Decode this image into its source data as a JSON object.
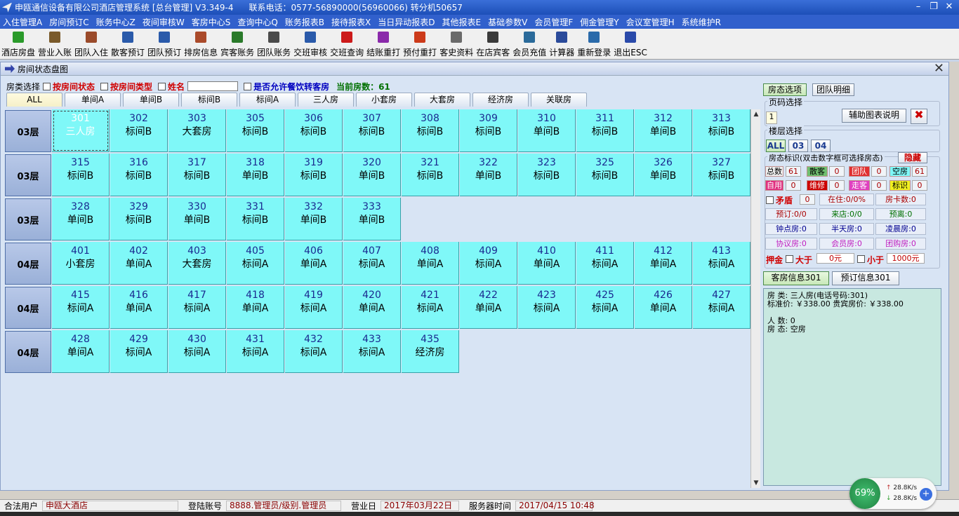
{
  "app": {
    "title": "申瓯通信设备有限公司酒店管理系统 [总台管理] V3.349-4",
    "phone": "联系电话：0577-56890000(56960066) 转分机50657"
  },
  "menu": [
    "入住管理A",
    "房间预订C",
    "账务中心Z",
    "夜间审核W",
    "客房中心S",
    "查询中心Q",
    "账务报表B",
    "接待报表X",
    "当日异动报表D",
    "其他报表E",
    "基础参数V",
    "会员管理F",
    "佣金管理Y",
    "会议室管理H",
    "系统维护R"
  ],
  "toolbar": [
    {
      "label": "酒店房盘",
      "icon": "house-icon",
      "color": "#2a9a2a"
    },
    {
      "label": "营业入账",
      "icon": "ledger-icon",
      "color": "#7a5a2a"
    },
    {
      "label": "团队入住",
      "icon": "group-checkin-icon",
      "color": "#9a4a2a"
    },
    {
      "label": "散客预订",
      "icon": "person-booking-icon",
      "color": "#2a5aaa"
    },
    {
      "label": "团队预订",
      "icon": "group-booking-icon",
      "color": "#2a5aaa"
    },
    {
      "label": "排房信息",
      "icon": "arrange-icon",
      "color": "#aa4a2a"
    },
    {
      "label": "宾客账务",
      "icon": "folder-icon",
      "color": "#2a7a2a"
    },
    {
      "label": "团队账务",
      "icon": "team-account-icon",
      "color": "#4a4a4a"
    },
    {
      "label": "交班审核",
      "icon": "magnifier-icon",
      "color": "#2a5aaa"
    },
    {
      "label": "交班查询",
      "icon": "red-book-icon",
      "color": "#cc1a1a"
    },
    {
      "label": "结账重打",
      "icon": "books-icon",
      "color": "#8a2aaa"
    },
    {
      "label": "预付重打",
      "icon": "receipt-icon",
      "color": "#cc3a1a"
    },
    {
      "label": "客史资料",
      "icon": "history-icon",
      "color": "#6a6a6a"
    },
    {
      "label": "在店宾客",
      "icon": "guest-list-icon",
      "color": "#3a3a3a"
    },
    {
      "label": "会员充值",
      "icon": "card-icon",
      "color": "#2a6a9a"
    },
    {
      "label": "计算器",
      "icon": "calculator-icon",
      "color": "#2a4a9a"
    },
    {
      "label": "重新登录",
      "icon": "relogin-icon",
      "color": "#2a6aaa"
    },
    {
      "label": "退出ESC",
      "icon": "exit-icon",
      "color": "#2a4aaa"
    }
  ],
  "window": {
    "title": "房间状态盘图"
  },
  "filter": {
    "room_type_label": "房类选择",
    "by_status": "按房间状态",
    "by_type": "按房间类型",
    "name_label": "姓名",
    "name_value": "",
    "allow_dining": "是否允许餐饮转客房",
    "current_rooms": "当前房数：61"
  },
  "tabs": [
    "ALL",
    "单间A",
    "单间B",
    "标间B",
    "标间A",
    "三人房",
    "小套房",
    "大套房",
    "经济房",
    "关联房"
  ],
  "floors": [
    {
      "label": "03层",
      "rooms": [
        {
          "no": "301",
          "type": "三人房"
        },
        {
          "no": "302",
          "type": "标间B"
        },
        {
          "no": "303",
          "type": "大套房"
        },
        {
          "no": "305",
          "type": "标间B"
        },
        {
          "no": "306",
          "type": "标间B"
        },
        {
          "no": "307",
          "type": "标间B"
        },
        {
          "no": "308",
          "type": "标间B"
        },
        {
          "no": "309",
          "type": "标间B"
        },
        {
          "no": "310",
          "type": "单间B"
        },
        {
          "no": "311",
          "type": "标间B"
        },
        {
          "no": "312",
          "type": "单间B"
        },
        {
          "no": "313",
          "type": "标间B"
        }
      ]
    },
    {
      "label": "03层",
      "rooms": [
        {
          "no": "315",
          "type": "标间B"
        },
        {
          "no": "316",
          "type": "标间B"
        },
        {
          "no": "317",
          "type": "标间B"
        },
        {
          "no": "318",
          "type": "单间B"
        },
        {
          "no": "319",
          "type": "标间B"
        },
        {
          "no": "320",
          "type": "单间B"
        },
        {
          "no": "321",
          "type": "标间B"
        },
        {
          "no": "322",
          "type": "单间B"
        },
        {
          "no": "323",
          "type": "标间B"
        },
        {
          "no": "325",
          "type": "标间B"
        },
        {
          "no": "326",
          "type": "单间B"
        },
        {
          "no": "327",
          "type": "标间B"
        }
      ]
    },
    {
      "label": "03层",
      "rooms": [
        {
          "no": "328",
          "type": "单间B"
        },
        {
          "no": "329",
          "type": "标间B"
        },
        {
          "no": "330",
          "type": "单间B"
        },
        {
          "no": "331",
          "type": "标间B"
        },
        {
          "no": "332",
          "type": "单间B"
        },
        {
          "no": "333",
          "type": "单间B"
        }
      ]
    },
    {
      "label": "04层",
      "rooms": [
        {
          "no": "401",
          "type": "小套房"
        },
        {
          "no": "402",
          "type": "单间A"
        },
        {
          "no": "403",
          "type": "大套房"
        },
        {
          "no": "405",
          "type": "标间A"
        },
        {
          "no": "406",
          "type": "单间A"
        },
        {
          "no": "407",
          "type": "标间A"
        },
        {
          "no": "408",
          "type": "单间A"
        },
        {
          "no": "409",
          "type": "标间A"
        },
        {
          "no": "410",
          "type": "单间A"
        },
        {
          "no": "411",
          "type": "标间A"
        },
        {
          "no": "412",
          "type": "单间A"
        },
        {
          "no": "413",
          "type": "标间A"
        }
      ]
    },
    {
      "label": "04层",
      "rooms": [
        {
          "no": "415",
          "type": "标间A"
        },
        {
          "no": "416",
          "type": "单间A"
        },
        {
          "no": "417",
          "type": "标间A"
        },
        {
          "no": "418",
          "type": "单间A"
        },
        {
          "no": "419",
          "type": "标间A"
        },
        {
          "no": "420",
          "type": "单间A"
        },
        {
          "no": "421",
          "type": "标间A"
        },
        {
          "no": "422",
          "type": "单间A"
        },
        {
          "no": "423",
          "type": "标间A"
        },
        {
          "no": "425",
          "type": "标间A"
        },
        {
          "no": "426",
          "type": "单间A"
        },
        {
          "no": "427",
          "type": "标间A"
        }
      ]
    },
    {
      "label": "04层",
      "rooms": [
        {
          "no": "428",
          "type": "单间A"
        },
        {
          "no": "429",
          "type": "标间A"
        },
        {
          "no": "430",
          "type": "标间A"
        },
        {
          "no": "431",
          "type": "标间A"
        },
        {
          "no": "432",
          "type": "标间A"
        },
        {
          "no": "433",
          "type": "标间A"
        },
        {
          "no": "435",
          "type": "经济房"
        }
      ]
    }
  ],
  "selected_room": "301",
  "right": {
    "btn_room_options": "房态选项",
    "btn_team_detail": "团队明细",
    "page_select": "页码选择",
    "page_value": "1",
    "legend_btn": "辅助图表说明",
    "floor_select": "楼层选择",
    "floor_buttons": [
      "ALL",
      "03",
      "04"
    ],
    "status_title": "房态标识(双击数字框可选择房态)",
    "hide": "隐藏",
    "total_label": "总数",
    "total_val": "61",
    "walkin_label": "散客",
    "walkin_val": "0",
    "group_label": "团队",
    "group_val": "0",
    "vacant_label": "空房",
    "vacant_val": "61",
    "self_label": "自用",
    "self_val": "0",
    "repair_label": "维修",
    "repair_val": "0",
    "wander_label": "走客",
    "wander_val": "0",
    "mark_label": "标识",
    "mark_val": "0",
    "conflict_label": "矛盾",
    "conflict_val": "0",
    "occupancy": "在住:0/0%",
    "roomcard": "房卡数:0",
    "reserve": "预订:0/0",
    "arrive": "来店:0/0",
    "depart": "预离:0",
    "hourly": "钟点房:0",
    "halfday": "半天房:0",
    "latenight": "凌晨房:0",
    "agreement": "协议房:0",
    "member": "会员房:0",
    "groupbuy": "团购房:0",
    "deposit": "押金",
    "gt": "大于",
    "gt_val": "0元",
    "lt": "小于",
    "lt_val": "1000元",
    "guest_info_btn": "客房信息301",
    "booking_info_btn": "预订信息301"
  },
  "info": {
    "line1": "房  类: 三人房(电话号码:301)",
    "line2": "标准价: ￥338.00  贵宾房价: ￥338.00",
    "line3": "人  数: 0",
    "line4": "房  态: 空房"
  },
  "status": {
    "user_label": "合法用户",
    "user_val": "申瓯大酒店",
    "login_label": "登陆账号",
    "login_val": "8888.管理员/级别.管理员",
    "bizday_label": "营业日",
    "bizday_val": "2017年03月22日",
    "server_label": "服务器时间",
    "server_val": "2017/04/15  10:48"
  },
  "network": {
    "percent": "69%",
    "up": "28.8K/s",
    "down": "28.8K/s"
  },
  "colors": {
    "room_vacant": "#7ff8f8",
    "floor_header": "#a8bce0",
    "title_bar": "#2a5cc8"
  }
}
